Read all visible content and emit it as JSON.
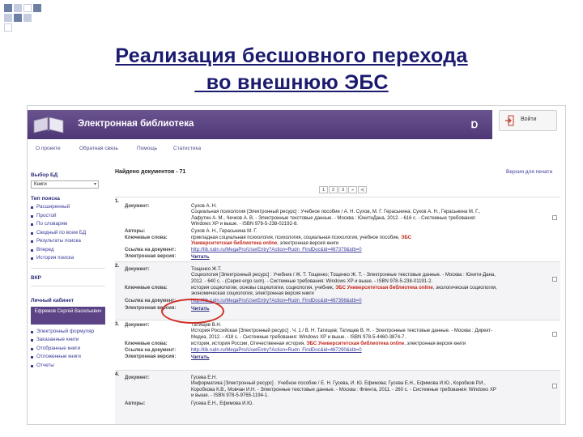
{
  "slide": {
    "title_line1": "Реализация бесшовного перехода",
    "title_line2": "  во внешнюю ЭБС"
  },
  "header": {
    "brand_title": "Электронная библиотека",
    "brand_logo": "Ɒ",
    "login_label": "Войти",
    "icons": {
      "logo": "book-icon",
      "login": "login-icon"
    }
  },
  "nav": {
    "items": [
      "О проекте",
      "Обратная связь",
      "Помощь",
      "Статистика"
    ]
  },
  "sidebar": {
    "db_heading": "Выбор БД",
    "db_value": "Книги",
    "search_heading": "Тип поиска",
    "search_items": [
      "Расширенный",
      "Простой",
      "По словарям",
      "Сводный по всем БД",
      "Результаты поиска",
      "Вперед",
      "История поиска"
    ],
    "vkr": "ВКР",
    "cabinet_heading": "Личный кабинет",
    "user_name": "Ефремов Сергей Васильевич",
    "cabinet_items": [
      "Электронный формуляр",
      "Заказанные книги",
      "Отобранные книги",
      "Отложенные книги",
      "Отчеты"
    ]
  },
  "main": {
    "found_label": "Найдено документов - 71",
    "print_link": "Версия для печати",
    "pages": [
      "1",
      "2",
      "3",
      "»",
      "»|"
    ],
    "labels": {
      "document": "Документ:",
      "authors": "Авторы:",
      "keywords": "Ключевые слова:",
      "link": "Ссылка на документ:",
      "ebook": "Электронная версия:"
    },
    "records": [
      {
        "num": "1.",
        "doc_lines": [
          "Сухов А. Н.",
          "Социальная психология [Электронный ресурс] : Учебное пособие / А. Н. Сухов, М. Г. Герасьнина; Сухов А. Н., Герасьнина М. Г.,",
          "Лафутин А. М., Чечков А. В. - Электронные текстовые данные. - Москва : ЮнитиДана, 2012. - 616 с. - Системные требования:",
          "Windows XP и выше. - ISBN 978-5-238-02192-8."
        ],
        "authors": "Сухов А. Н., Герасьнина М. Г.",
        "keywords_pre": "прикладная социальная психология, психология, социальная психология, учебное пособие, ",
        "keywords_hl": "ЭБС",
        "keywords_line2_hl": "Университетская библиотека online",
        "keywords_line2_post": ", электронная версия книги",
        "link": "http://lib.rudn.ru/MegaPro/UserEntry?Action=Rudn_FindDoc&id=467379&idb=0",
        "ebook": "Читать"
      },
      {
        "num": "2.",
        "doc_lines": [
          "Тощенко Ж.Т.",
          "Социология [Электронный ресурс] : Учебник / Ж. Т. Тощенко; Тощенко Ж. Т. - Электронные текстовые данные. - Москва : Юнити-Дана,",
          "2012. - 640 с. - (Серия ergo sum). - Системные требования: Windows XP и выше. - ISBN 978-5-238-01191-2."
        ],
        "keywords_line1_pre": "история социологии, основы социологии, социология, учебник, ",
        "keywords_line1_hl": "ЭБС Университетская библиотека online",
        "keywords_line1_post": ", экологическая социология,",
        "keywords_line2": "экономическая социология, электронная версия книги",
        "link": "http://lib.rudn.ru/MegaPro/UserEntry?Action=Rudn_FindDoc&id=467398&idb=0",
        "ebook": "Читать"
      },
      {
        "num": "3.",
        "doc_lines": [
          "Татищев В.Н.",
          "История Российская [Электронный ресурс] . Ч. 1 / В. Н. Татищев; Татищев В. Н. - Электронные текстовые данные. - Москва : Директ-",
          "Медиа, 2012. - 418 с. - Системные требования: Windows XP и выше. - ISBN 978-5-4460-3874-7."
        ],
        "keywords_pre": "история, история России, Отечественная история, ",
        "keywords_hl": "ЭБС Университетская библиотека online",
        "keywords_post": ", электронная версия книги",
        "link": "http://lib.rudn.ru/MegaPro/UserEntry?Action=Rudn_FindDoc&id=467290&idb=0",
        "ebook": "Читать"
      },
      {
        "num": "4.",
        "doc_lines": [
          "Гусева Е.Н.",
          "Информатика [Электронный ресурс] . Учебное пособие / Е. Н. Гусева, И. Ю. Ефимова; Гусева Е.Н., Ефимова И.Ю., Коробков Р.И.,",
          "Коробкова К.В., Мовчан И.Н. - Электронные текстовые данные. - Москва : Флинта, 2011. - 260 с. - Системные требования: Windows XP",
          "и выше. - ISBN 978-5-9765-1194-1."
        ],
        "authors": "Гусева Е.Н., Ефимова И.Ю."
      }
    ]
  }
}
